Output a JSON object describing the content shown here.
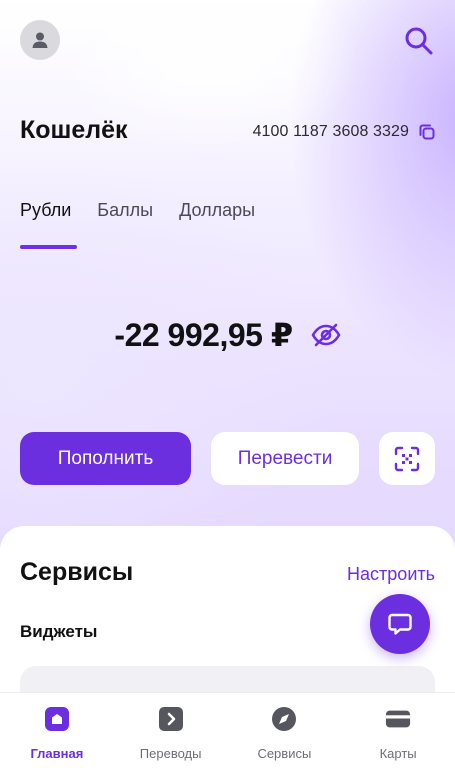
{
  "header": {
    "avatar_icon": "user-icon",
    "search_icon": "search-icon"
  },
  "wallet": {
    "title": "Кошелёк",
    "account_number": "4100 1187 3608 3329",
    "copy_icon": "copy-icon"
  },
  "tabs": [
    {
      "label": "Рубли",
      "active": true
    },
    {
      "label": "Баллы",
      "active": false
    },
    {
      "label": "Доллары",
      "active": false
    }
  ],
  "balance": {
    "amount": "-22 992,95 ₽",
    "visibility_icon": "eye-off-icon"
  },
  "actions": {
    "top_up_label": "Пополнить",
    "transfer_label": "Перевести",
    "qr_icon": "qr-scan-icon"
  },
  "services": {
    "title": "Сервисы",
    "configure_label": "Настроить",
    "widgets_label": "Виджеты"
  },
  "chat_icon": "chat-icon",
  "bottom_nav": [
    {
      "label": "Главная",
      "icon": "home-icon",
      "active": true
    },
    {
      "label": "Переводы",
      "icon": "transfers-icon",
      "active": false
    },
    {
      "label": "Сервисы",
      "icon": "services-icon",
      "active": false
    },
    {
      "label": "Карты",
      "icon": "card-icon",
      "active": false
    }
  ],
  "colors": {
    "accent": "#6c2fe0",
    "inactive_nav": "#6d6d78",
    "text": "#111111"
  }
}
